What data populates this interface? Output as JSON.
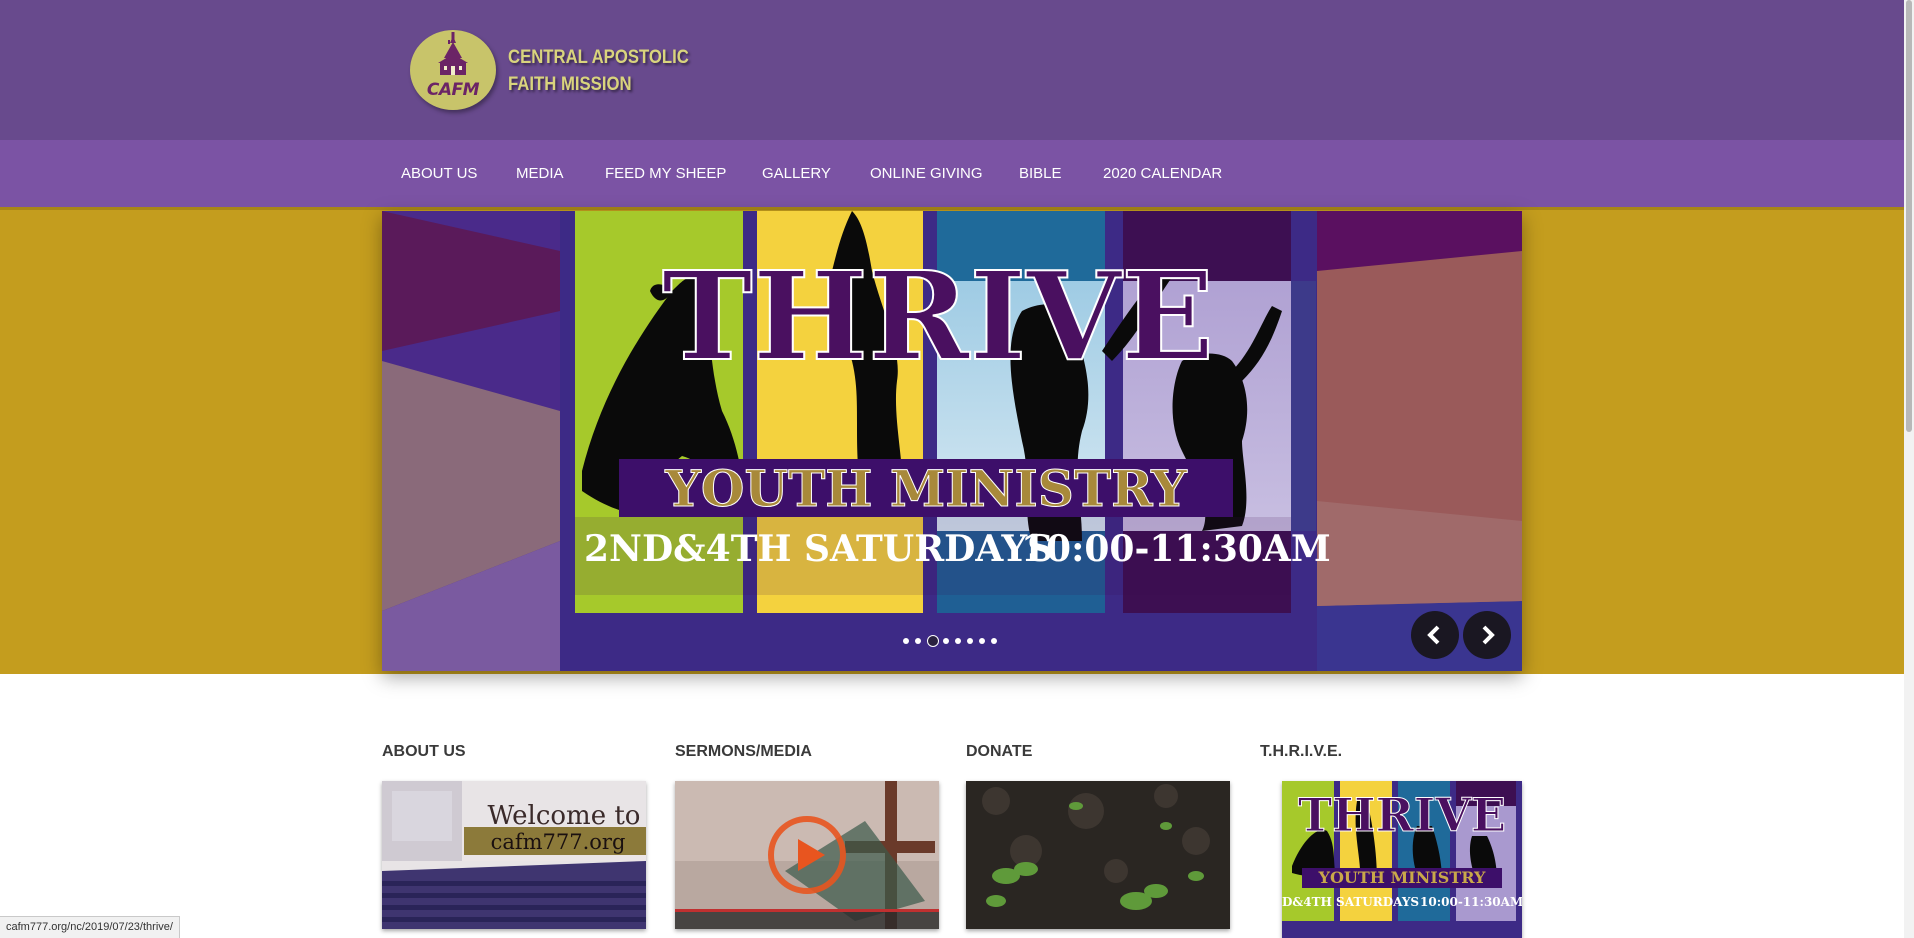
{
  "header": {
    "logo_letters": "CAFM",
    "org_name_line1": "CENTRAL APOSTOLIC",
    "org_name_line2": "FAITH MISSION"
  },
  "nav": {
    "items": [
      {
        "label": "ABOUT US"
      },
      {
        "label": "MEDIA"
      },
      {
        "label": "FEED MY SHEEP"
      },
      {
        "label": "GALLERY"
      },
      {
        "label": "ONLINE GIVING"
      },
      {
        "label": "BIBLE"
      },
      {
        "label": "2020 CALENDAR"
      }
    ]
  },
  "slider": {
    "headline": "THRIVE",
    "subheadline": "YOUTH MINISTRY",
    "schedule": "2ND&4TH SATURDAYS",
    "time": "10:00-11:30AM",
    "slide_count": 8,
    "active_slide": 3,
    "prev_icon": "chevron-left-icon",
    "next_icon": "chevron-right-icon"
  },
  "sections": [
    {
      "title": "ABOUT US",
      "thumb_text_line1": "Welcome to",
      "thumb_text_line2": "cafm777.org"
    },
    {
      "title": "SERMONS/MEDIA",
      "thumb_icon": "play-icon"
    },
    {
      "title": "DONATE"
    },
    {
      "title": "T.H.R.I.V.E.",
      "thumb_headline": "THRIVE",
      "thumb_sub": "YOUTH MINISTRY",
      "thumb_schedule": "D&4TH SATURDAYS",
      "thumb_time": "10:00-11:30AM"
    }
  ],
  "statusbar": {
    "url": "cafm777.org/nc/2019/07/23/thrive/"
  },
  "colors": {
    "header_bg": "#684a8d",
    "nav_bg": "#7b53a4",
    "hero_bg": "#c49d1e",
    "logo_gold": "#c8c46a",
    "thrive_purple": "#3d0f52"
  }
}
